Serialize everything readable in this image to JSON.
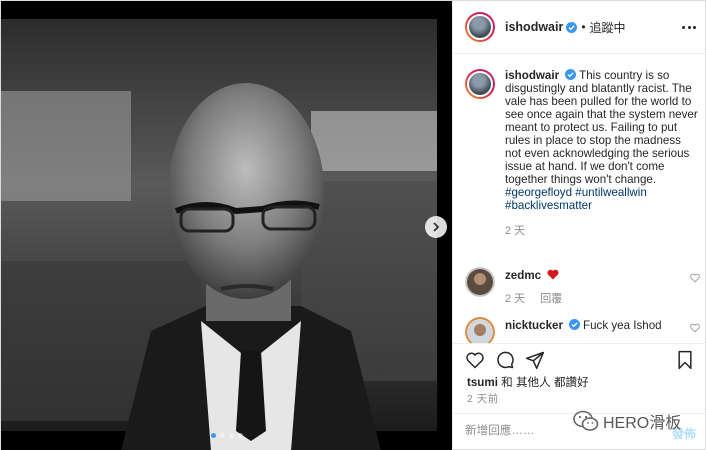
{
  "post": {
    "author": "ishodwair",
    "follow_state": "追蹤中",
    "separator": "•"
  },
  "caption": {
    "username": "ishodwair",
    "text": "This country is so disgustingly and blatantly racist. The vale has been pulled for the world to see once again that the system never meant to protect us. Failing to put rules in place to stop the madness not even acknowledging the serious issue at hand. If we don't come together things won't change.",
    "hashtags": [
      "#georgefloyd",
      "#untilweallwin",
      "#backlivesmatter"
    ],
    "time": "2 天"
  },
  "comments": [
    {
      "username": "zedmc",
      "text": "",
      "time": "2 天",
      "reply_label": "回覆",
      "emoji": "red-heart-emoji"
    },
    {
      "username": "nicktucker",
      "text": "Fuck yea Ishod",
      "time": "",
      "reply_label": ""
    }
  ],
  "likes": {
    "first_user": "tsumi",
    "rest": " 和 其他人 都讚好"
  },
  "posted_time": "2 天前",
  "add_comment": {
    "placeholder": "新增回應……",
    "post_label": "發佈"
  },
  "carousel": {
    "slides": 4,
    "active": 0
  },
  "watermark": {
    "text": "HERO滑板"
  },
  "colors": {
    "verified": "#3897f0",
    "hashtag": "#00376b",
    "secondary": "#8e8e8e",
    "post_button": "#b2dffc"
  }
}
